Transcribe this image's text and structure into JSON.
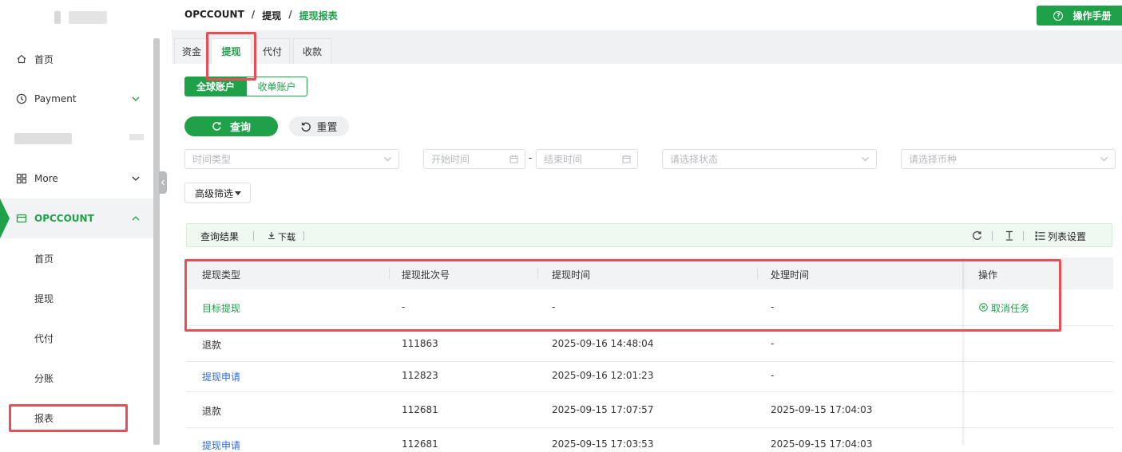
{
  "sidebar": {
    "items": [
      {
        "label": "首页"
      },
      {
        "label": "Payment"
      },
      {
        "label": "More"
      },
      {
        "label": "OPCCOUNT"
      }
    ],
    "sub_items": [
      {
        "label": "首页"
      },
      {
        "label": "提现"
      },
      {
        "label": "代付"
      },
      {
        "label": "分账"
      },
      {
        "label": "报表"
      }
    ]
  },
  "header": {
    "breadcrumb": [
      "OPCCOUNT",
      "提现",
      "提现报表"
    ],
    "separator": "/",
    "manual_button": "操作手册",
    "manual_icon": "?"
  },
  "tabs": [
    {
      "label": "资金"
    },
    {
      "label": "提现"
    },
    {
      "label": "代付"
    },
    {
      "label": "收款"
    }
  ],
  "account_switch": {
    "on": "全球账户",
    "off": "收单账户"
  },
  "actions": {
    "query": "查询",
    "reset": "重置"
  },
  "filters": {
    "time_type": "时间类型",
    "start_time": "开始时间",
    "end_time": "结束时间",
    "date_dash": "-",
    "status": "请选择状态",
    "currency": "请选择币种",
    "advanced": "高级筛选"
  },
  "result_bar": {
    "title": "查询结果",
    "download": "下载",
    "column_settings": "列表设置"
  },
  "table": {
    "columns": [
      "提现类型",
      "提现批次号",
      "提现时间",
      "处理时间",
      "操作"
    ],
    "rows": [
      {
        "type": "目标提现",
        "batch": "-",
        "time": "-",
        "processed": "-",
        "action": "取消任务"
      },
      {
        "type": "退款",
        "batch": "111863",
        "time": "2025-09-16 14:48:04",
        "processed": "-",
        "action": ""
      },
      {
        "type": "提现申请",
        "batch": "112823",
        "time": "2025-09-16 12:01:23",
        "processed": "-",
        "action": ""
      },
      {
        "type": "退款",
        "batch": "112681",
        "time": "2025-09-15 17:07:57",
        "processed": "2025-09-15 17:04:03",
        "action": ""
      },
      {
        "type": "提现申请",
        "batch": "112681",
        "time": "2025-09-15 17:03:53",
        "processed": "2025-09-15 17:04:03",
        "action": ""
      }
    ]
  },
  "colors": {
    "accent": "#1fa14a",
    "link": "#2f6bd6",
    "annotation": "#e84e55"
  }
}
